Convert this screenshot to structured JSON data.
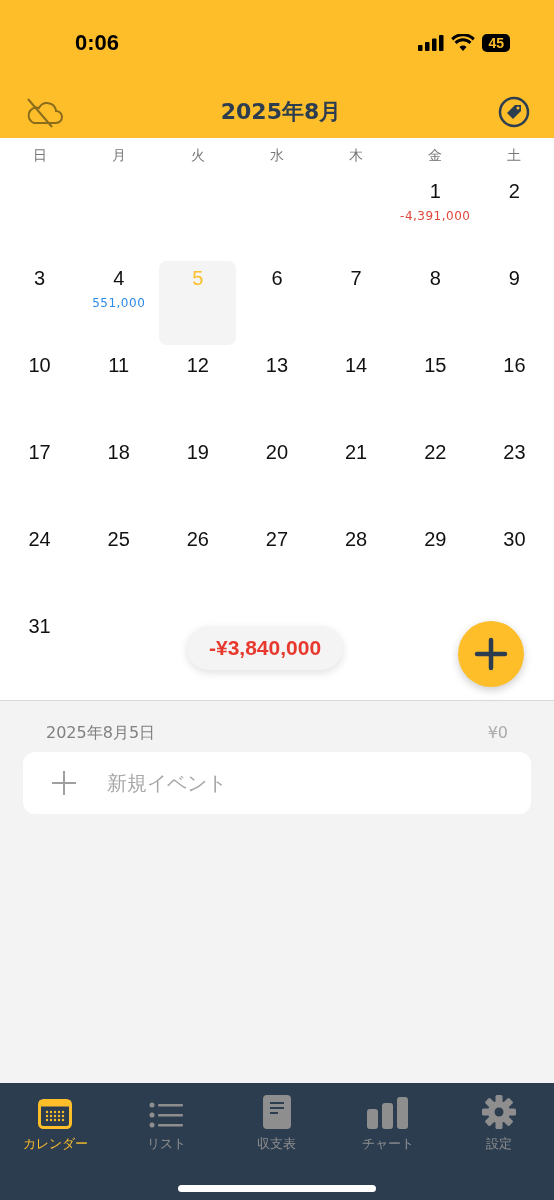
{
  "status_bar": {
    "time": "0:06",
    "battery": "45"
  },
  "header": {
    "title": "2025年8月"
  },
  "weekdays": [
    "日",
    "月",
    "火",
    "水",
    "木",
    "金",
    "土"
  ],
  "weeks": [
    [
      {
        "day": "1",
        "amount": "-4,391,000",
        "kind": "expense",
        "selected": false
      },
      {
        "day": "2",
        "selected": false
      }
    ],
    [
      {
        "day": "3",
        "selected": false
      },
      {
        "day": "4",
        "amount": "551,000",
        "kind": "income",
        "selected": false
      },
      {
        "day": "5",
        "selected": true
      },
      {
        "day": "6",
        "selected": false
      },
      {
        "day": "7",
        "selected": false
      },
      {
        "day": "8",
        "selected": false
      },
      {
        "day": "9",
        "selected": false
      }
    ],
    [
      {
        "day": "10",
        "selected": false
      },
      {
        "day": "11",
        "selected": false
      },
      {
        "day": "12",
        "selected": false
      },
      {
        "day": "13",
        "selected": false
      },
      {
        "day": "14",
        "selected": false
      },
      {
        "day": "15",
        "selected": false
      },
      {
        "day": "16",
        "selected": false
      }
    ],
    [
      {
        "day": "17",
        "selected": false
      },
      {
        "day": "18",
        "selected": false
      },
      {
        "day": "19",
        "selected": false
      },
      {
        "day": "20",
        "selected": false
      },
      {
        "day": "21",
        "selected": false
      },
      {
        "day": "22",
        "selected": false
      },
      {
        "day": "23",
        "selected": false
      }
    ],
    [
      {
        "day": "24",
        "selected": false
      },
      {
        "day": "25",
        "selected": false
      },
      {
        "day": "26",
        "selected": false
      },
      {
        "day": "27",
        "selected": false
      },
      {
        "day": "28",
        "selected": false
      },
      {
        "day": "29",
        "selected": false
      },
      {
        "day": "30",
        "selected": false
      }
    ],
    [
      {
        "day": "31",
        "selected": false
      }
    ]
  ],
  "month_total": "-¥3,840,000",
  "day_detail": {
    "date": "2025年8月5日",
    "total": "¥0",
    "new_event": "新規イベント"
  },
  "tabs": [
    {
      "label": "カレンダー",
      "kind": "calendar",
      "selected": true
    },
    {
      "label": "リスト",
      "kind": "list",
      "selected": false
    },
    {
      "label": "収支表",
      "kind": "document",
      "selected": false
    },
    {
      "label": "チャート",
      "kind": "chart",
      "selected": false
    },
    {
      "label": "設定",
      "kind": "gear",
      "selected": false
    }
  ]
}
